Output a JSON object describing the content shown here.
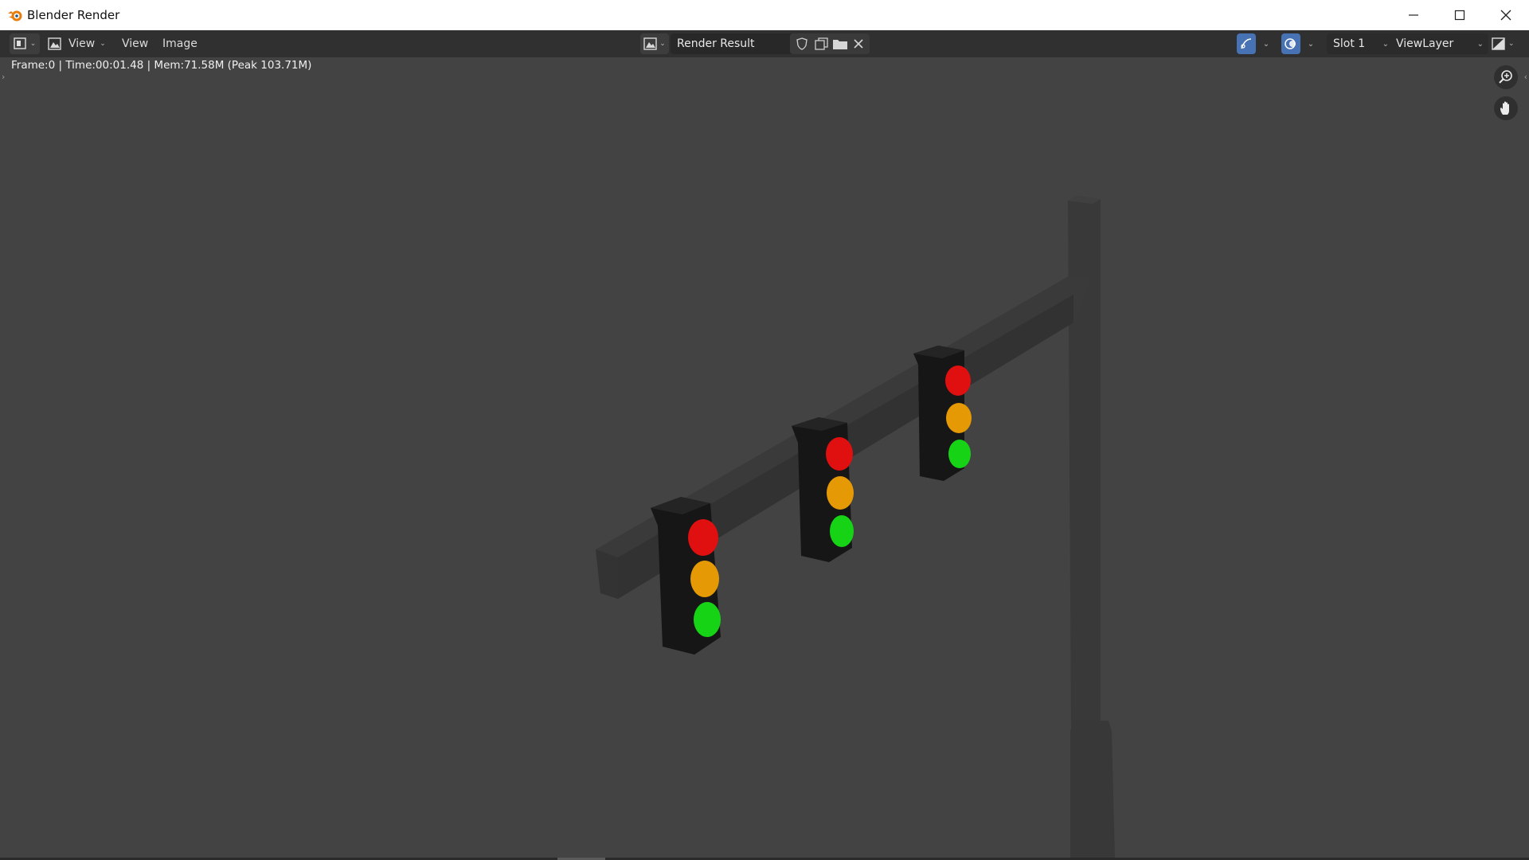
{
  "window": {
    "title": "Blender Render",
    "icons": {
      "logo": "blender-logo-icon",
      "minimize": "minimize-icon",
      "maximize": "maximize-icon",
      "close": "close-icon"
    }
  },
  "toolbar": {
    "editor_type_icon": "image-editor-icon",
    "view_mode_label": "View",
    "menus": [
      "View",
      "Image"
    ],
    "image_browse_icon": "image-browse-icon",
    "image_name": "Render Result",
    "fake_user_icon": "shield-icon",
    "new_image_icon": "duplicate-icon",
    "open_image_icon": "folder-icon",
    "unlink_icon": "close-icon",
    "gizmo_icon": "gizmo-icon",
    "overlay_icon": "overlay-icon",
    "slot": "Slot 1",
    "view_layer": "ViewLayer",
    "display_channels_icon": "display-channels-icon",
    "accent": "#4772b3"
  },
  "status": {
    "text": "Frame:0 | Time:00:01.48 | Mem:71.58M (Peak 103.71M)"
  },
  "viewport": {
    "background": "#434343",
    "zoom_icon": "zoom-icon",
    "pan_icon": "hand-icon",
    "scene": {
      "objects": [
        "pole",
        "arm",
        "traffic-light-1",
        "traffic-light-2",
        "traffic-light-3"
      ],
      "light_colors": {
        "red": "#e01010",
        "amber": "#e59a05",
        "green": "#16d316"
      }
    }
  }
}
